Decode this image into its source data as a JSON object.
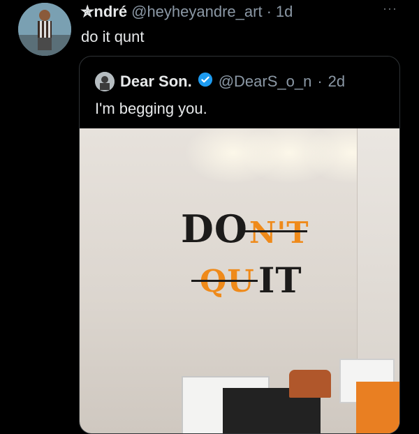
{
  "tweet": {
    "display_name": "✯ndré",
    "handle": "@heyheyandre_art",
    "separator": "·",
    "age": "1d",
    "text": "do it qunt",
    "more_label": "···"
  },
  "quoted_tweet": {
    "display_name": "Dear Son.",
    "handle": "@DearS_o_n",
    "separator": "·",
    "age": "2d",
    "text": "I'm begging you.",
    "verified_color": "#1d9bf0"
  },
  "photo_sign": {
    "line1_black": "DO",
    "line1_orange": "N'T",
    "line2_orange": "QU",
    "line2_black": "IT"
  },
  "colors": {
    "background": "#000000",
    "border": "#2f3336",
    "meta_text": "#8b98a5",
    "sign_orange": "#ef8a1a"
  }
}
